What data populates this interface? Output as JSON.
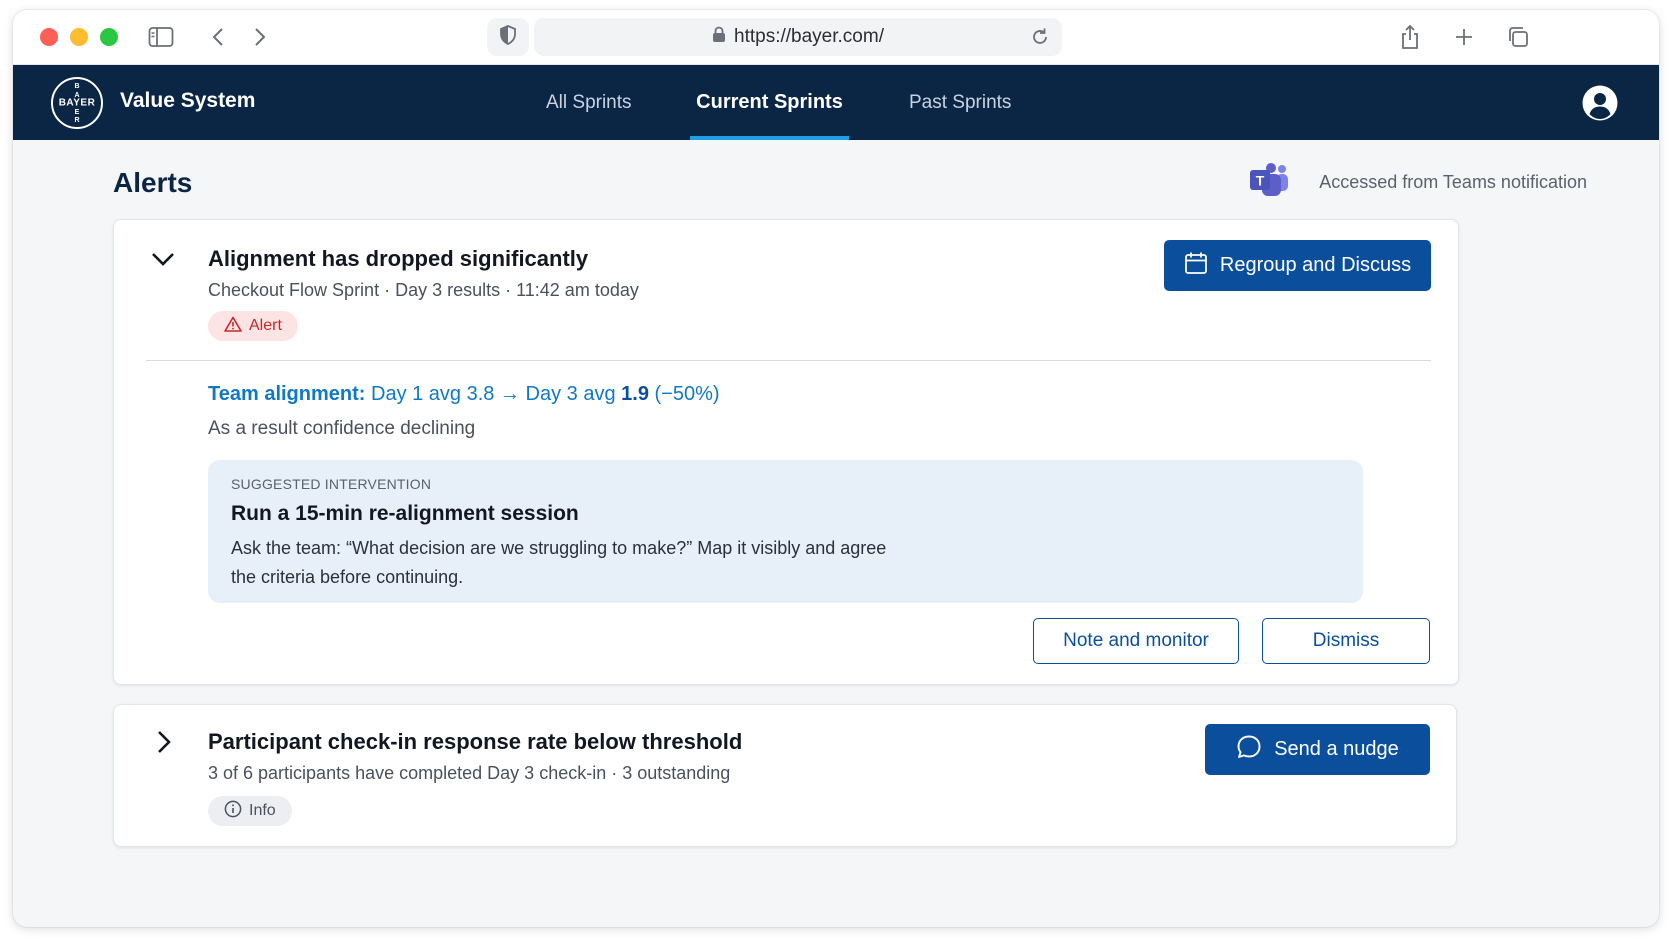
{
  "browser": {
    "url": "https://bayer.com/"
  },
  "app": {
    "logo_text_horizontal": "BAYER",
    "logo_text_vertical": "BAYER",
    "title": "Value System",
    "nav": [
      {
        "label": "All Sprints",
        "active": false
      },
      {
        "label": "Current Sprints",
        "active": true
      },
      {
        "label": "Past Sprints",
        "active": false
      }
    ]
  },
  "page": {
    "title": "Alerts",
    "teams_note": "Accessed from Teams notification"
  },
  "alerts": [
    {
      "expanded": true,
      "title": "Alignment has dropped significantly",
      "meta": "Checkout Flow Sprint · Day 3 results · 11:42 am today",
      "badge": "Alert",
      "action": "Regroup and Discuss",
      "metric": {
        "label": "Team alignment:",
        "text_before": "Day 1 avg 3.8 → Day 3 avg",
        "value": "1.9",
        "change": "(−50%)"
      },
      "sub_metric": "As a result confidence declining",
      "intervention": {
        "label": "SUGGESTED INTERVENTION",
        "title": "Run a 15-min re-alignment session",
        "body": "Ask the team: “What decision are we struggling to make?” Map it visibly and agree the criteria before continuing."
      },
      "secondary_actions": [
        "Note and monitor",
        "Dismiss"
      ]
    },
    {
      "expanded": false,
      "title": "Participant check-in response rate below threshold",
      "meta": "3 of 6 participants have completed Day 3 check-in · 3 outstanding",
      "badge": "Info",
      "action": "Send a nudge"
    }
  ],
  "colors": {
    "header_bg": "#0b2545",
    "primary": "#0b4f9c",
    "link": "#1178c4",
    "active_tab_underline": "#1f9fe8",
    "alert_badge_bg": "#fde4e4",
    "alert_badge_text": "#c62828",
    "intervention_bg": "#e7eff9"
  },
  "icons": [
    "sidebar-icon",
    "back-icon",
    "forward-icon",
    "shield-icon",
    "lock-icon",
    "reload-icon",
    "share-icon",
    "new-tab-icon",
    "tabs-icon",
    "user-icon",
    "teams-icon",
    "chevron-down-icon",
    "chevron-right-icon",
    "warning-icon",
    "info-icon",
    "calendar-icon",
    "chat-bubble-icon"
  ]
}
